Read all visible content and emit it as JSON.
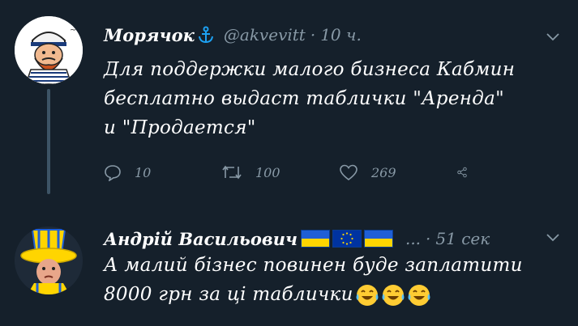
{
  "tweets": [
    {
      "name": "Морячок",
      "name_emoji": "anchor",
      "handle": "@akvevitt",
      "separator": "·",
      "time": "10 ч.",
      "lines": [
        "Для поддержки малого бизнеса Кабмин",
        "бесплатно выдаст таблички \"Аренда\"",
        "и \"Продается\""
      ],
      "actions": {
        "reply_count": "10",
        "retweet_count": "100",
        "like_count": "269"
      }
    },
    {
      "name": "Андрій Васильович",
      "name_emoji": "flags-ua-eu-ua",
      "handle": "...",
      "separator": "·",
      "time": "51 сек",
      "lines": [
        "А малий бізнес повинен буде заплатити",
        "8000 грн за ці таблички"
      ],
      "trailing_emoji": "tears-of-joy ×3"
    }
  ],
  "colors": {
    "background": "#15202b",
    "text": "#ffffff",
    "secondary": "#8899a6",
    "thread_line": "#3d5466",
    "anchor": "#1da1f2"
  }
}
